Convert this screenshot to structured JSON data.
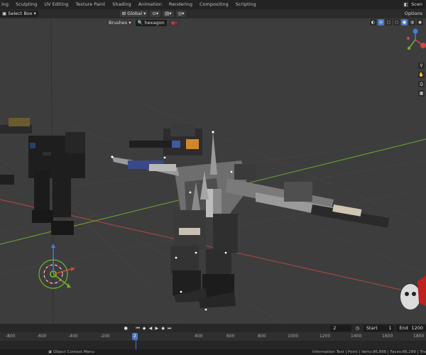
{
  "workspace_tabs": [
    "ing",
    "Sculpting",
    "UV Editing",
    "Texture Paint",
    "Shading",
    "Animation",
    "Rendering",
    "Compositing",
    "Scripting"
  ],
  "scene_label": "Scen",
  "options_label": "Options",
  "toolbar": {
    "select_box": "Select Box",
    "orientation": "Global"
  },
  "paint_header": {
    "brushes": "Brushes",
    "brush_name": "hexagon"
  },
  "timeline": {
    "current_frame": "2",
    "start_label": "Start",
    "start_value": "1",
    "end_label": "End",
    "end_value": "1200",
    "ruler_ticks": [
      "-800",
      "-600",
      "-400",
      "-200",
      "2",
      "400",
      "600",
      "800",
      "1000",
      "1200",
      "1400",
      "1600",
      "1800"
    ]
  },
  "statusbar": {
    "left": "Object Context Menu",
    "right": "Information Text | Point | Verts:96,898 | Faces:66,299 | Tris:67,6"
  },
  "colors": {
    "accent": "#4a78c8",
    "axis_x": "#d24545",
    "axis_y": "#72b02e",
    "axis_z": "#3f7fe0"
  },
  "icons": [
    "mode-icon",
    "transform-pivot-icon",
    "snap-icon",
    "proportional-icon",
    "view-icon",
    "overlay-icon",
    "shading-icon",
    "zoom-icon",
    "hand-icon",
    "camera-icon",
    "grid-icon"
  ]
}
